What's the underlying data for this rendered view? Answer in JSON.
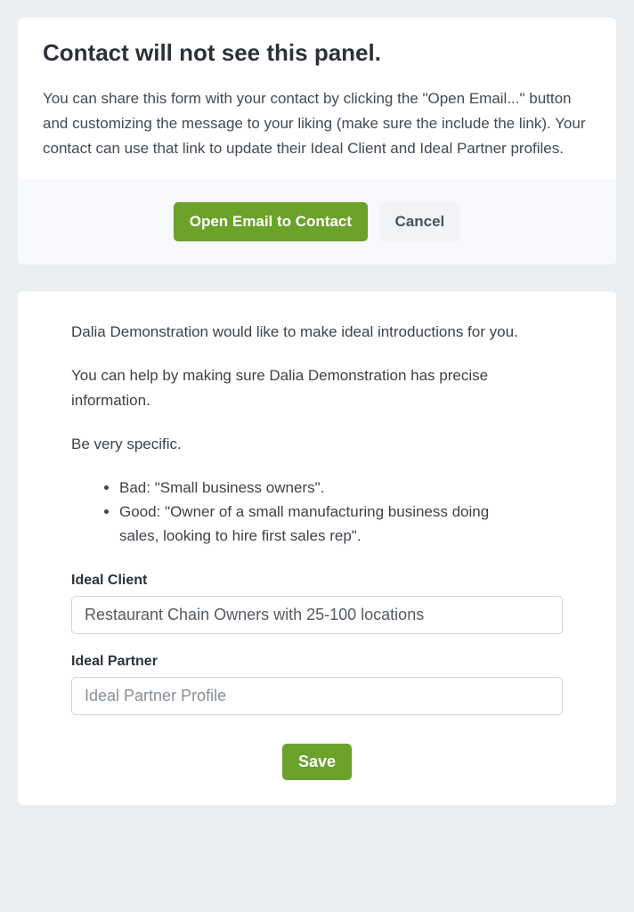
{
  "notice": {
    "title": "Contact will not see this panel.",
    "description": "You can share this form with your contact by clicking the \"Open Email...\" button and customizing the message to your liking (make sure the include the link). Your contact can use that link to update their Ideal Client and Ideal Partner profiles.",
    "actions": {
      "open_email_label": "Open Email to Contact",
      "cancel_label": "Cancel"
    }
  },
  "form": {
    "intro_1": "Dalia Demonstration would like to make ideal introductions for you.",
    "intro_2": "You can help by making sure Dalia Demonstration has precise information.",
    "intro_3": "Be very specific.",
    "bullets": {
      "bad": "Bad: \"Small business owners\".",
      "good": "Good: \"Owner of a small manufacturing business doing sales, looking to hire first sales rep\"."
    },
    "fields": {
      "ideal_client": {
        "label": "Ideal Client",
        "value": "Restaurant Chain Owners with 25-100 locations"
      },
      "ideal_partner": {
        "label": "Ideal Partner",
        "placeholder": "Ideal Partner Profile"
      }
    },
    "save_label": "Save"
  }
}
